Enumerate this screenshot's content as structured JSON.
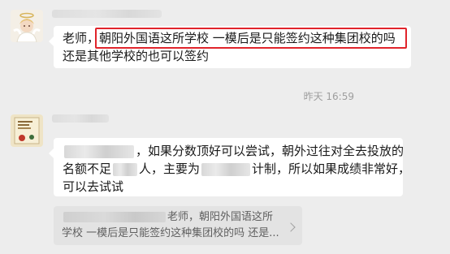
{
  "messages": [
    {
      "avatar_icon": "angel-avatar-icon",
      "text_prefix": "老师，",
      "highlighted": "朝阳外国语这所学校 一模后是只能签约这种集团校的吗",
      "line2": "还是其他学校的也可以签约"
    },
    {
      "avatar_icon": "book-cover-avatar-icon",
      "line1_after_blur": "，如果分数顶好可以尝试，朝外过往对全去投放的",
      "line2_a": "名额不足",
      "line2_b": "人，主要为",
      "line2_c": "计制，所以如果成绩非常好，",
      "line3": "可以去试试"
    }
  ],
  "timestamp": "昨天 16:59",
  "quote": {
    "line1": "老师，朝阳外国语这所",
    "line2": "学校 一模后是只能签约这种集团校的吗 还是..."
  },
  "colors": {
    "background": "#ededed",
    "bubble": "#ffffff",
    "highlight_border": "#e0242b",
    "quote_bg": "#e3e3e3"
  }
}
